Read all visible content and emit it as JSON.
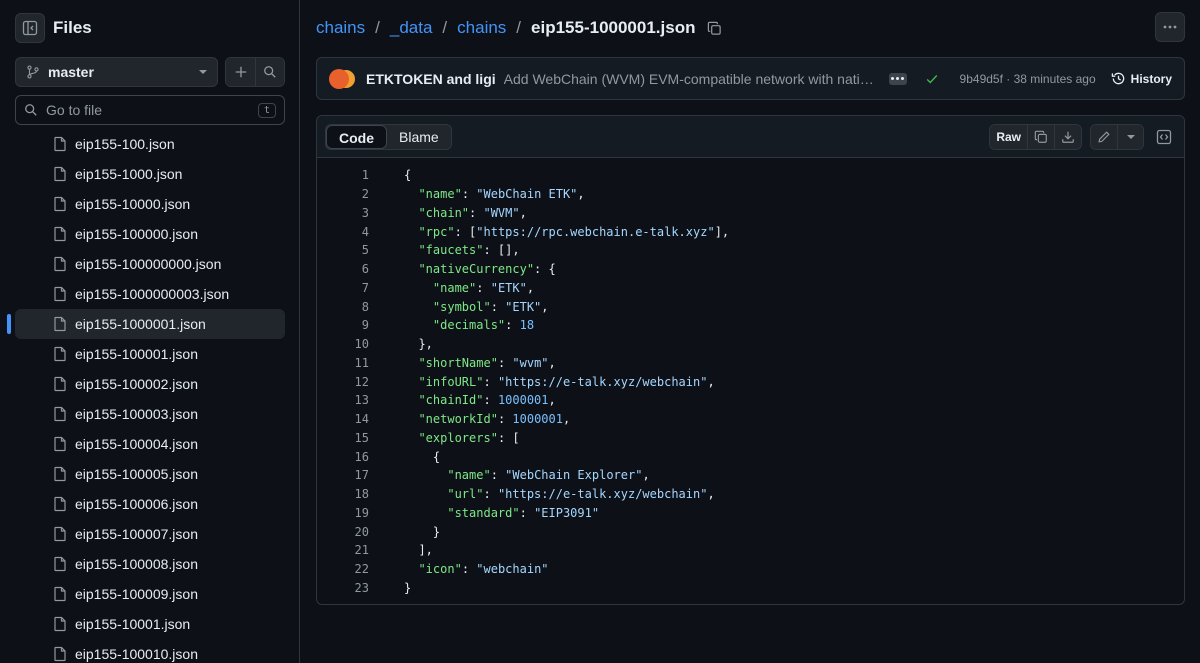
{
  "sidebar": {
    "title": "Files",
    "branch": "master",
    "goto_placeholder": "Go to file",
    "goto_shortcut": "t",
    "files": [
      "eip155-100.json",
      "eip155-1000.json",
      "eip155-10000.json",
      "eip155-100000.json",
      "eip155-100000000.json",
      "eip155-1000000003.json",
      "eip155-1000001.json",
      "eip155-100001.json",
      "eip155-100002.json",
      "eip155-100003.json",
      "eip155-100004.json",
      "eip155-100005.json",
      "eip155-100006.json",
      "eip155-100007.json",
      "eip155-100008.json",
      "eip155-100009.json",
      "eip155-10001.json",
      "eip155-100010.json"
    ],
    "active_file": "eip155-1000001.json"
  },
  "breadcrumb": {
    "parts": [
      "chains",
      "_data",
      "chains"
    ],
    "current": "eip155-1000001.json",
    "sep": "/"
  },
  "commit": {
    "authors": "ETKTOKEN and ligi",
    "message": "Add WebChain (WVM) EVM-compatible network with native ETK",
    "sha_time": "9b49d5f · 38 minutes ago",
    "history_label": "History"
  },
  "file_header": {
    "tabs": [
      "Code",
      "Blame"
    ],
    "selected_tab": "Code",
    "raw_label": "Raw"
  },
  "code_lines": [
    "{",
    "  \"name\": \"WebChain ETK\",",
    "  \"chain\": \"WVM\",",
    "  \"rpc\": [\"https://rpc.webchain.e-talk.xyz\"],",
    "  \"faucets\": [],",
    "  \"nativeCurrency\": {",
    "    \"name\": \"ETK\",",
    "    \"symbol\": \"ETK\",",
    "    \"decimals\": 18",
    "  },",
    "  \"shortName\": \"wvm\",",
    "  \"infoURL\": \"https://e-talk.xyz/webchain\",",
    "  \"chainId\": 1000001,",
    "  \"networkId\": 1000001,",
    "  \"explorers\": [",
    "    {",
    "      \"name\": \"WebChain Explorer\",",
    "      \"url\": \"https://e-talk.xyz/webchain\",",
    "      \"standard\": \"EIP3091\"",
    "    }",
    "  ],",
    "  \"icon\": \"webchain\"",
    "}"
  ],
  "colors": {
    "background": "#0d1117",
    "link": "#4493f8",
    "json_key": "#7ee787",
    "json_string": "#a5d6ff",
    "json_number": "#79c0ff",
    "success": "#3fb950"
  }
}
